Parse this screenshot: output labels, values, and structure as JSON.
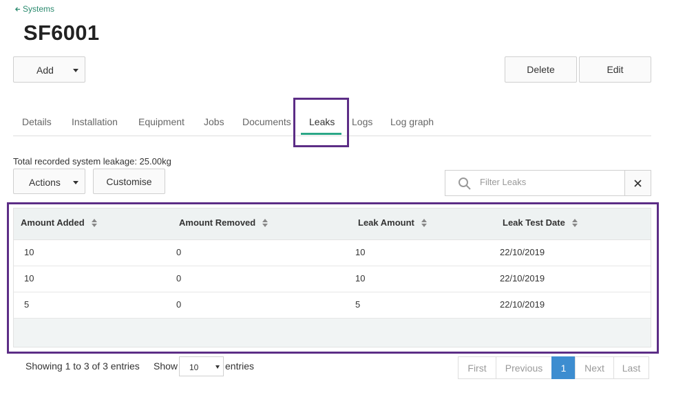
{
  "breadcrumb": {
    "label": "Systems"
  },
  "page": {
    "title": "SF6001"
  },
  "toolbar": {
    "add_label": "Add",
    "delete_label": "Delete",
    "edit_label": "Edit"
  },
  "tabs": [
    {
      "label": "Details"
    },
    {
      "label": "Installation"
    },
    {
      "label": "Equipment"
    },
    {
      "label": "Jobs"
    },
    {
      "label": "Documents"
    },
    {
      "label": "Leaks",
      "active": true
    },
    {
      "label": "Logs"
    },
    {
      "label": "Log graph"
    }
  ],
  "summary": {
    "total_text": "Total recorded system leakage: 25.00kg"
  },
  "actions": {
    "actions_label": "Actions",
    "customise_label": "Customise"
  },
  "filter": {
    "placeholder": "Filter Leaks",
    "value": ""
  },
  "table": {
    "columns": [
      "Amount Added",
      "Amount Removed",
      "Leak Amount",
      "Leak Test Date"
    ],
    "rows": [
      [
        "10",
        "0",
        "10",
        "22/10/2019"
      ],
      [
        "10",
        "0",
        "10",
        "22/10/2019"
      ],
      [
        "5",
        "0",
        "5",
        "22/10/2019"
      ]
    ]
  },
  "footer": {
    "info": "Showing 1 to 3 of 3 entries",
    "show_label": "Show",
    "page_length": "10",
    "entries_label": "entries"
  },
  "pagination": {
    "first": "First",
    "previous": "Previous",
    "current": "1",
    "next": "Next",
    "last": "Last"
  },
  "colors": {
    "accent": "#2aa686",
    "highlight": "#5c2d86",
    "page_active": "#3d8dd0"
  },
  "icons": {
    "back": "arrow-left-icon",
    "search": "search-icon",
    "clear": "close-icon",
    "sort": "sort-icon"
  }
}
